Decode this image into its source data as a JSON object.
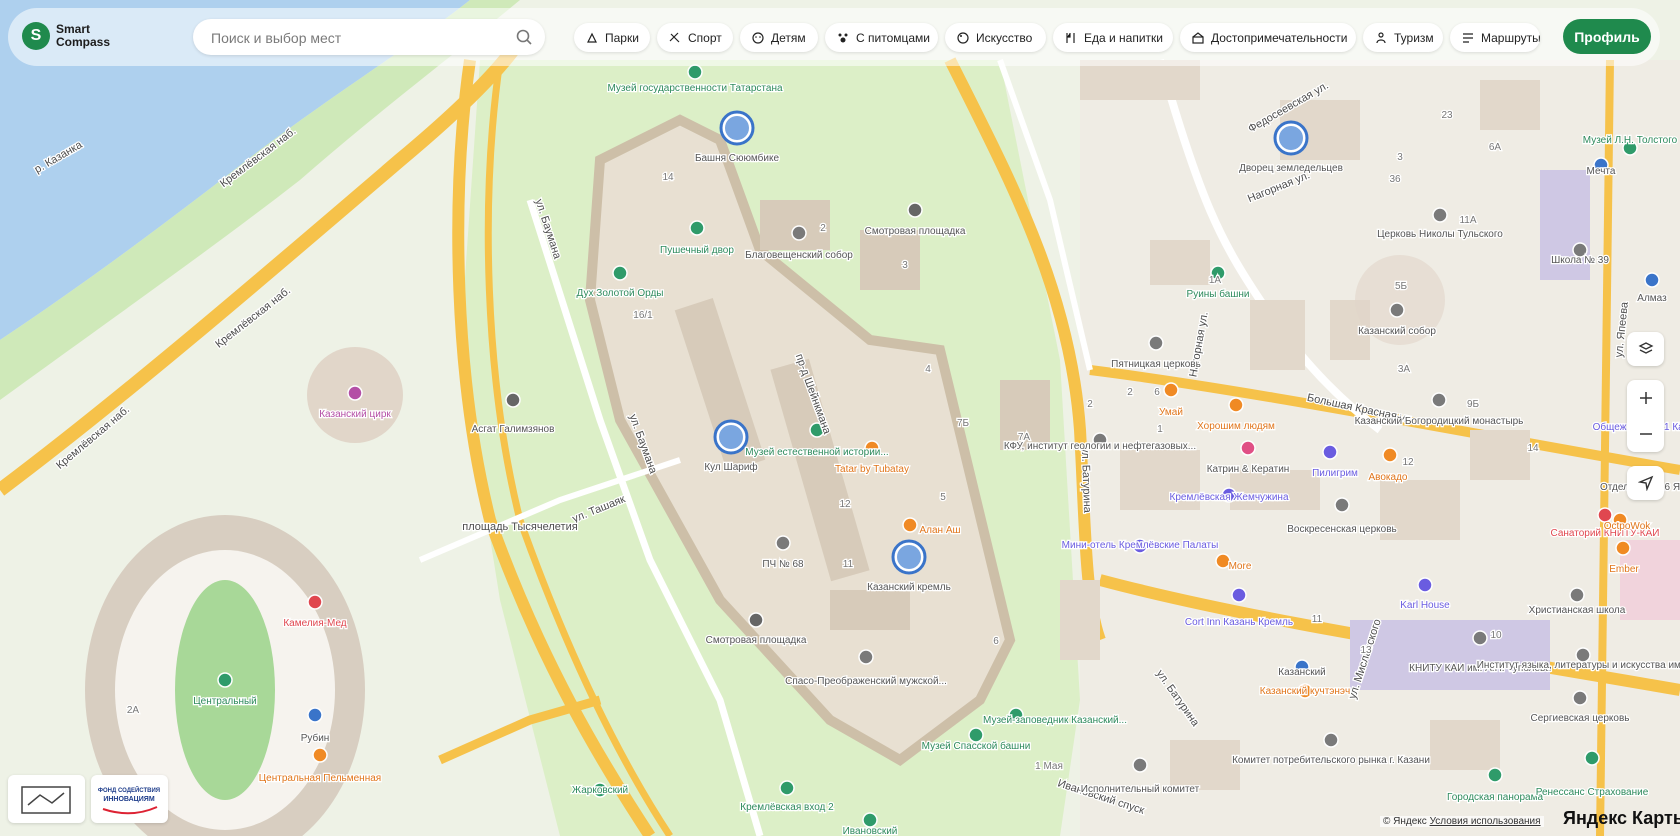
{
  "app": {
    "logo_line1": "Smart",
    "logo_line2": "Compass",
    "profile_label": "Профиль"
  },
  "search": {
    "placeholder": "Поиск и выбор мест",
    "value": ""
  },
  "categories": [
    {
      "label": "Парки",
      "icon": "park-icon"
    },
    {
      "label": "Спорт",
      "icon": "sport-icon"
    },
    {
      "label": "Детям",
      "icon": "kids-icon"
    },
    {
      "label": "С питомцами",
      "icon": "pets-icon"
    },
    {
      "label": "Искусство",
      "icon": "art-icon"
    },
    {
      "label": "Еда и напитки",
      "icon": "food-icon"
    },
    {
      "label": "Достопримечательности",
      "icon": "landmark-icon"
    },
    {
      "label": "Туризм",
      "icon": "tourism-icon"
    },
    {
      "label": "Маршруты",
      "icon": "routes-icon"
    }
  ],
  "map": {
    "street_labels": [
      "Кремлёвская наб.",
      "Кремлёвская наб.",
      "Кремлёвская наб.",
      "ул. Баумана",
      "ул. Баумана",
      "пр-д Шейнкмана",
      "ул. Ташаяк",
      "ул. Батурина",
      "ул. Батурина",
      "Нагорная ул.",
      "Нагорная ул.",
      "Федосеевская ул.",
      "Большая Красная ул.",
      "ул. Миславского",
      "ул. Япеева",
      "Ивановский спуск",
      "р. Казанка",
      "площадь Тысячелетия"
    ],
    "places": [
      {
        "name": "Башня Сююмбике",
        "type": "landmark"
      },
      {
        "name": "Кул Шариф",
        "type": "landmark"
      },
      {
        "name": "Казанский кремль",
        "type": "landmark"
      },
      {
        "name": "Дворец земледельцев",
        "type": "landmark"
      },
      {
        "name": "Музей государственности Татарстана",
        "type": "museum"
      },
      {
        "name": "Пушечный двор",
        "type": "sight"
      },
      {
        "name": "Благовещенский собор",
        "type": "church"
      },
      {
        "name": "Смотровая площадка",
        "type": "viewpoint"
      },
      {
        "name": "Дух Золотой Орды",
        "type": "museum"
      },
      {
        "name": "Асгат Галимзянов",
        "type": "monument"
      },
      {
        "name": "Казанский цирк",
        "type": "circus"
      },
      {
        "name": "Музей естественной истории...",
        "type": "museum"
      },
      {
        "name": "Tatar by Tubatay",
        "type": "food"
      },
      {
        "name": "Алан Аш",
        "type": "food"
      },
      {
        "name": "ПЧ № 68",
        "type": "service"
      },
      {
        "name": "Смотровая площадка",
        "type": "viewpoint"
      },
      {
        "name": "Спасо-Преображенский мужской...",
        "type": "church"
      },
      {
        "name": "Музей-заповедник Казанский...",
        "type": "museum"
      },
      {
        "name": "Музей Спасской башни",
        "type": "museum"
      },
      {
        "name": "Кремлёвская вход 2",
        "type": "metro"
      },
      {
        "name": "Центральный",
        "type": "stadium"
      },
      {
        "name": "Камелия-Мед",
        "type": "medical"
      },
      {
        "name": "Рубин",
        "type": "shop"
      },
      {
        "name": "Центральная Пельменная",
        "type": "food"
      },
      {
        "name": "Музей Л.Н. Толстого",
        "type": "museum"
      },
      {
        "name": "Мечта",
        "type": "shop"
      },
      {
        "name": "Церковь Николы Тульского",
        "type": "church"
      },
      {
        "name": "Руины башни",
        "type": "sight"
      },
      {
        "name": "Школа № 39",
        "type": "school"
      },
      {
        "name": "Казанский собор",
        "type": "church"
      },
      {
        "name": "Пятницкая церковь",
        "type": "church"
      },
      {
        "name": "Умай",
        "type": "food"
      },
      {
        "name": "Хорошим людям",
        "type": "food"
      },
      {
        "name": "Казанский Богородицкий монастырь",
        "type": "church"
      },
      {
        "name": "Общежитие № 1 Каи",
        "type": "hotel"
      },
      {
        "name": "КФУ, институт геологии и нефтегазовых...",
        "type": "education"
      },
      {
        "name": "Катрин & Кератин",
        "type": "beauty"
      },
      {
        "name": "Пилигрим",
        "type": "hotel"
      },
      {
        "name": "Авокадо",
        "type": "food"
      },
      {
        "name": "Отдел по № 16 Я",
        "type": "service"
      },
      {
        "name": "Кремлёвская Жемчужина",
        "type": "hotel"
      },
      {
        "name": "Воскресенская церковь",
        "type": "church"
      },
      {
        "name": "Санаторий КНИТУ-КАИ",
        "type": "medical"
      },
      {
        "name": "OctpoWok",
        "type": "food"
      },
      {
        "name": "Мини-отель Кремлёвские Палаты",
        "type": "hotel"
      },
      {
        "name": "More",
        "type": "food"
      },
      {
        "name": "Ember",
        "type": "food"
      },
      {
        "name": "Cort Inn Казань Кремль",
        "type": "hotel"
      },
      {
        "name": "Karl House",
        "type": "hotel"
      },
      {
        "name": "Христианская школа",
        "type": "school"
      },
      {
        "name": "КНИТУ КАИ им. А.Н. Туполева",
        "type": "education"
      },
      {
        "name": "Институт языка, литературы и искусства им...",
        "type": "education"
      },
      {
        "name": "Казанский",
        "type": "shop"
      },
      {
        "name": "Казанский кучтэнэч",
        "type": "food"
      },
      {
        "name": "Сергиевская церковь",
        "type": "church"
      },
      {
        "name": "Исполнительный комитет",
        "type": "government"
      },
      {
        "name": "Комитет потребительского рынка г. Казани",
        "type": "government"
      },
      {
        "name": "Городская панорама",
        "type": "museum"
      },
      {
        "name": "Ренессанс Страхование",
        "type": "office"
      },
      {
        "name": "Алмаз",
        "type": "shop"
      },
      {
        "name": "Жарковский",
        "type": "sight"
      },
      {
        "name": "Ивановский",
        "type": "sight"
      }
    ],
    "house_numbers": [
      "14",
      "2",
      "3",
      "16/1",
      "4",
      "7Б",
      "7А",
      "12",
      "11",
      "5",
      "6",
      "3",
      "36",
      "23",
      "6А",
      "2",
      "11А",
      "1А",
      "5Б",
      "1",
      "3А",
      "9Б",
      "2",
      "6",
      "12",
      "10",
      "11",
      "14",
      "2А",
      "13",
      "1 Мая"
    ]
  },
  "controls": {
    "layers_icon": "layers-icon",
    "zoom_in_icon": "plus-icon",
    "zoom_out_icon": "minus-icon",
    "locate_icon": "location-arrow-icon"
  },
  "attribution": {
    "copyright": "© Яндекс",
    "terms_link": "Условия использования",
    "brand": "Яндекс Карты"
  },
  "badges": [
    {
      "label": "badge-left",
      "icon": "map-badge-icon"
    },
    {
      "label": "ФОНД СОДЕЙСТВИЯ ИННОВАЦИЯМ",
      "icon": "fund-logo-icon"
    }
  ],
  "colors": {
    "brand_green": "#1f8a4d",
    "road_yellow": "#f6c24a",
    "water": "#aed0ee",
    "park": "#d3ecbf",
    "building": "#e2d8cb"
  }
}
